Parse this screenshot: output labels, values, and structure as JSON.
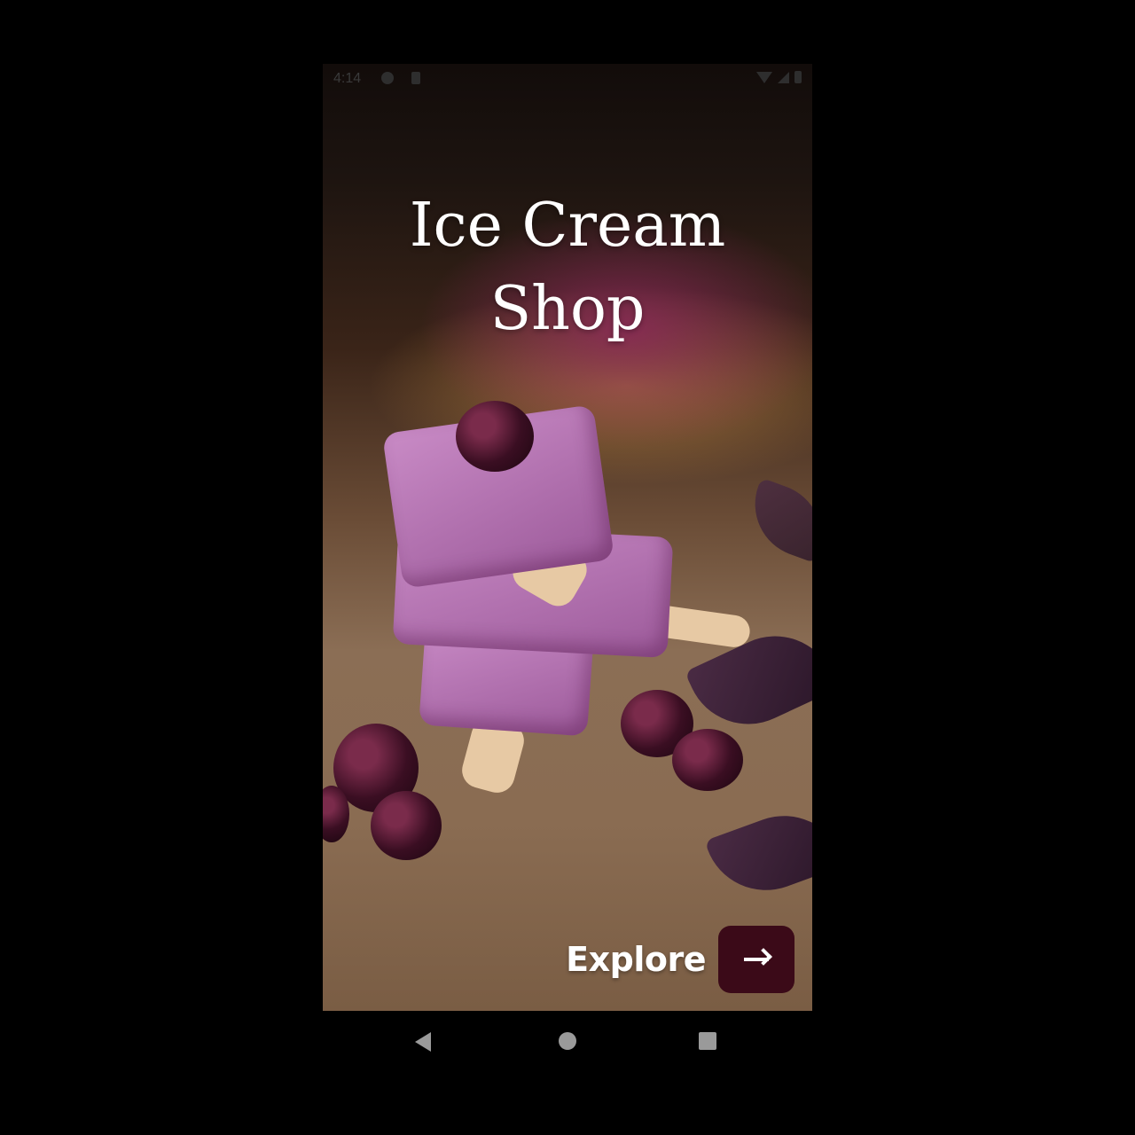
{
  "status_bar": {
    "time": "4:14",
    "icons": [
      "app-notification-icon",
      "sim-card-icon",
      "wifi-icon",
      "signal-icon",
      "battery-icon"
    ]
  },
  "splash": {
    "title_line1": "Ice  Cream",
    "title_line2": "Shop",
    "explore_label": "Explore",
    "explore_button_icon": "arrow-right-icon",
    "accent_color": "#3b0a18"
  },
  "navigation_bar": {
    "buttons": [
      "back-icon",
      "home-icon",
      "recents-icon"
    ]
  }
}
